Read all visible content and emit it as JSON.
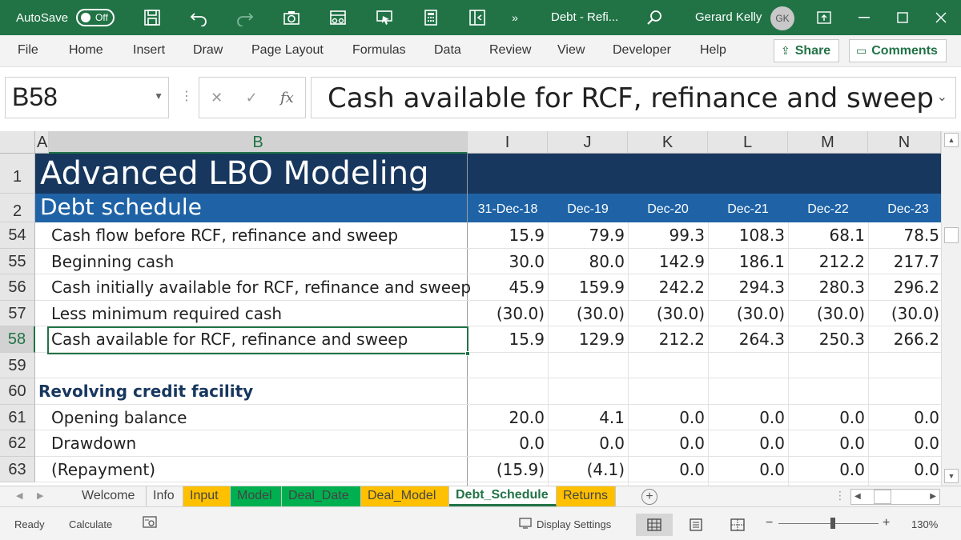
{
  "titlebar": {
    "autosave_label": "AutoSave",
    "autosave_state": "Off",
    "doc_title": "Debt - Refi...",
    "user_name": "Gerard Kelly",
    "user_initials": "GK"
  },
  "ribbon": {
    "tabs": [
      "File",
      "Home",
      "Insert",
      "Draw",
      "Page Layout",
      "Formulas",
      "Data",
      "Review",
      "View",
      "Developer",
      "Help"
    ],
    "share_label": "Share",
    "comments_label": "Comments"
  },
  "formula_bar": {
    "name_box": "B58",
    "content": "Cash available for RCF, refinance and sweep",
    "fx_label": "fx"
  },
  "grid": {
    "columns": [
      "A",
      "B",
      "I",
      "J",
      "K",
      "L",
      "M",
      "N"
    ],
    "title": "Advanced LBO Modeling",
    "subtitle": "Debt schedule",
    "date_headers": [
      "31-Dec-18",
      "Dec-19",
      "Dec-20",
      "Dec-21",
      "Dec-22",
      "Dec-23"
    ],
    "rows": [
      {
        "num": "54",
        "label": "Cash flow before RCF, refinance and sweep",
        "values": [
          "15.9",
          "79.9",
          "99.3",
          "108.3",
          "68.1",
          "78.5"
        ]
      },
      {
        "num": "55",
        "label": "Beginning cash",
        "values": [
          "30.0",
          "80.0",
          "142.9",
          "186.1",
          "212.2",
          "217.7"
        ]
      },
      {
        "num": "56",
        "label": "Cash initially available for RCF, refinance and sweep",
        "values": [
          "45.9",
          "159.9",
          "242.2",
          "294.3",
          "280.3",
          "296.2"
        ]
      },
      {
        "num": "57",
        "label": "Less minimum required cash",
        "values": [
          "(30.0)",
          "(30.0)",
          "(30.0)",
          "(30.0)",
          "(30.0)",
          "(30.0)"
        ]
      },
      {
        "num": "58",
        "label": "Cash available for RCF, refinance and sweep",
        "values": [
          "15.9",
          "129.9",
          "212.2",
          "264.3",
          "250.3",
          "266.2"
        ]
      },
      {
        "num": "59",
        "label": "",
        "values": [
          "",
          "",
          "",
          "",
          "",
          ""
        ]
      },
      {
        "num": "60",
        "label": "Revolving credit facility",
        "values": [
          "",
          "",
          "",
          "",
          "",
          ""
        ],
        "section": true
      },
      {
        "num": "61",
        "label": "Opening balance",
        "values": [
          "20.0",
          "4.1",
          "0.0",
          "0.0",
          "0.0",
          "0.0"
        ]
      },
      {
        "num": "62",
        "label": "Drawdown",
        "values": [
          "0.0",
          "0.0",
          "0.0",
          "0.0",
          "0.0",
          "0.0"
        ]
      },
      {
        "num": "63",
        "label": "(Repayment)",
        "values": [
          "(15.9)",
          "(4.1)",
          "0.0",
          "0.0",
          "0.0",
          "0.0"
        ]
      }
    ]
  },
  "sheets": {
    "tabs": [
      {
        "name": "Welcome",
        "color": ""
      },
      {
        "name": "Info",
        "color": ""
      },
      {
        "name": "Input",
        "color": "#ffc000"
      },
      {
        "name": "Model",
        "color": "#00b050"
      },
      {
        "name": "Deal_Date",
        "color": "#00b050"
      },
      {
        "name": "Deal_Model",
        "color": "#ffc000"
      },
      {
        "name": "Debt_Schedule",
        "color": "#ffc000",
        "active": true
      },
      {
        "name": "Returns",
        "color": "#ffc000"
      }
    ]
  },
  "statusbar": {
    "ready": "Ready",
    "calculate": "Calculate",
    "display_settings": "Display Settings",
    "zoom_minus": "−",
    "zoom_plus": "+",
    "zoom": "130%"
  }
}
